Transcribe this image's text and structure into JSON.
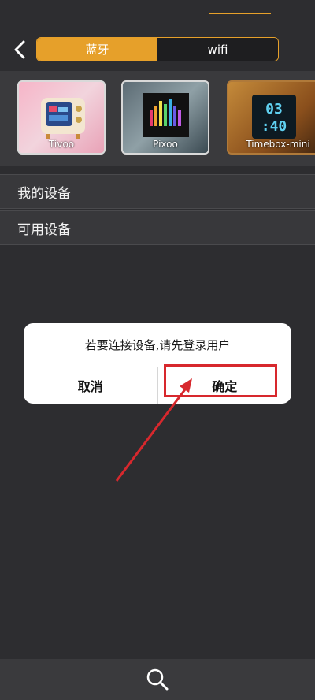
{
  "header": {
    "tabs": [
      {
        "label": "蓝牙",
        "active": true
      },
      {
        "label": "wifi",
        "active": false
      }
    ]
  },
  "devices": [
    {
      "name": "Tivoo",
      "icon": "device-thumbnail-tivoo"
    },
    {
      "name": "Pixoo",
      "icon": "device-thumbnail-pixoo"
    },
    {
      "name": "Timebox-mini",
      "icon": "device-thumbnail-timebox-mini"
    }
  ],
  "sections": {
    "my_devices": "我的设备",
    "available_devices": "可用设备"
  },
  "dialog": {
    "message": "若要连接设备,请先登录用户",
    "cancel_label": "取消",
    "confirm_label": "确定"
  },
  "colors": {
    "accent": "#e6a02a",
    "background": "#2d2d30",
    "highlight": "#d7282d"
  }
}
